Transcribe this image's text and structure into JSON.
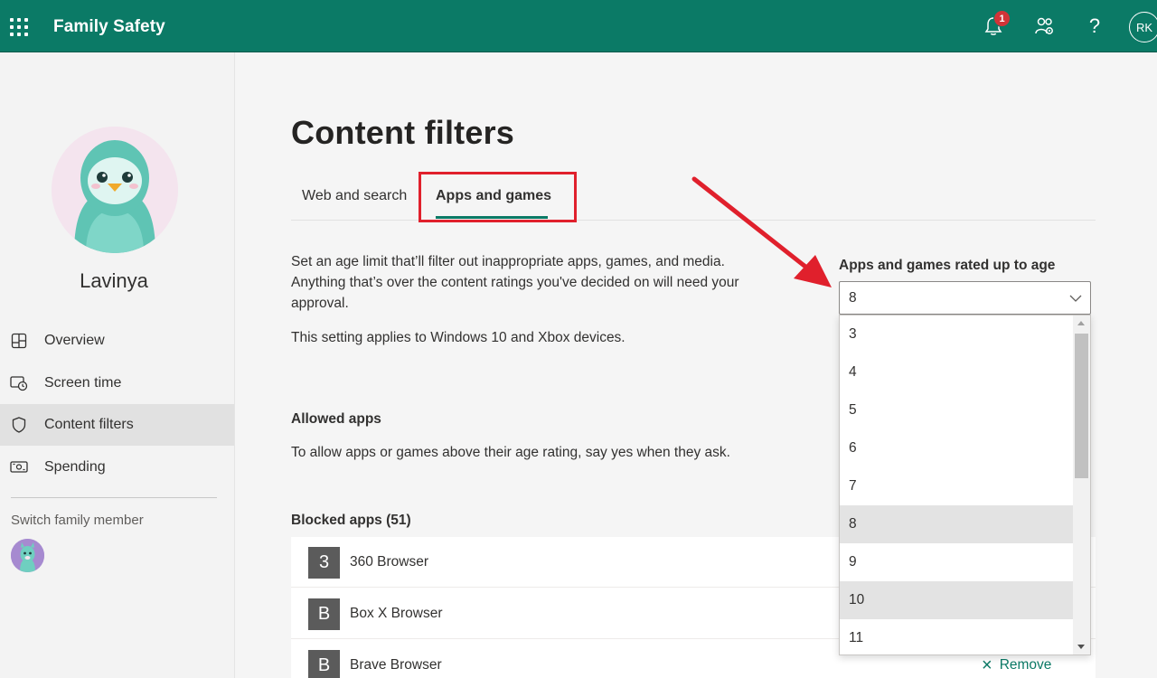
{
  "header": {
    "app_title": "Family Safety",
    "notification_count": "1",
    "help_label": "?",
    "user_initials": "RK",
    "brand_color": "#0b7a66"
  },
  "sidebar": {
    "member_name": "Lavinya",
    "items": [
      {
        "label": "Overview",
        "icon": "overview-icon"
      },
      {
        "label": "Screen time",
        "icon": "screen-time-icon"
      },
      {
        "label": "Content filters",
        "icon": "shield-icon",
        "active": true
      },
      {
        "label": "Spending",
        "icon": "spending-icon"
      }
    ],
    "switch_label": "Switch family member"
  },
  "main": {
    "title": "Content filters",
    "tabs": [
      {
        "label": "Web and search"
      },
      {
        "label": "Apps and games",
        "active": true
      }
    ],
    "description": "Set an age limit that’ll filter out inappropriate apps, games, and media. Anything that’s over the content ratings you've decided on will need your approval.",
    "applies_to": "This setting applies to Windows 10 and Xbox devices.",
    "allowed": {
      "heading": "Allowed apps",
      "text": "To allow apps or games above their age rating, say yes when they ask."
    },
    "blocked": {
      "heading": "Blocked apps (51)",
      "apps": [
        {
          "tile": "3",
          "name": "360 Browser"
        },
        {
          "tile": "B",
          "name": "Box X Browser"
        },
        {
          "tile": "B",
          "name": "Brave Browser"
        }
      ],
      "remove_label": "Remove"
    },
    "age_filter": {
      "label": "Apps and games rated up to age",
      "selected": "8",
      "options": [
        "3",
        "4",
        "5",
        "6",
        "7",
        "8",
        "9",
        "10",
        "11"
      ],
      "hovered": "10"
    }
  }
}
